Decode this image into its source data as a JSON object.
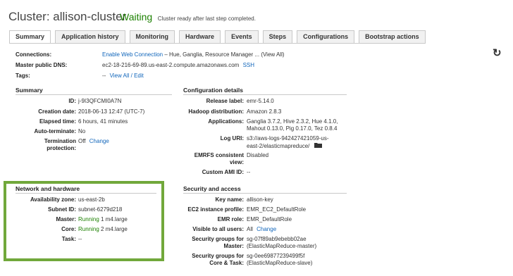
{
  "header": {
    "title": "Cluster: allison-cluster",
    "status": "Waiting",
    "status_message": "Cluster ready after last step completed."
  },
  "tabs": [
    {
      "label": "Summary",
      "active": true
    },
    {
      "label": "Application history"
    },
    {
      "label": "Monitoring"
    },
    {
      "label": "Hardware"
    },
    {
      "label": "Events"
    },
    {
      "label": "Steps"
    },
    {
      "label": "Configurations"
    },
    {
      "label": "Bootstrap actions"
    }
  ],
  "top": {
    "connections_label": "Connections:",
    "connections_link": "Enable Web Connection",
    "connections_rest": " – Hue, Ganglia, Resource Manager ... (View All)",
    "dns_label": "Master public DNS:",
    "dns_value": "ec2-18-216-69-89.us-east-2.compute.amazonaws.com",
    "ssh_link": "SSH",
    "tags_label": "Tags:",
    "tags_prefix": "--",
    "tags_link": "View All / Edit"
  },
  "summary": {
    "heading": "Summary",
    "id_label": "ID:",
    "id_value": "j-9I3QFCMI0A7N",
    "creation_label": "Creation date:",
    "creation_value": "2018-06-13 12:47 (UTC-7)",
    "elapsed_label": "Elapsed time:",
    "elapsed_value": "6 hours, 41 minutes",
    "autoterm_label": "Auto-terminate:",
    "autoterm_value": "No",
    "termprot_label_1": "Termination",
    "termprot_label_2": "protection:",
    "termprot_value": "Off",
    "termprot_change": "Change"
  },
  "config": {
    "heading": "Configuration details",
    "release_label": "Release label:",
    "release_value": "emr-5.14.0",
    "hadoop_label": "Hadoop distribution:",
    "hadoop_value": "Amazon 2.8.3",
    "apps_label": "Applications:",
    "apps_value_1": "Ganglia 3.7.2, Hive 2.3.2, Hue 4.1.0,",
    "apps_value_2": "Mahout 0.13.0, Pig 0.17.0, Tez 0.8.4",
    "log_label": "Log URI:",
    "log_value_1": "s3://aws-logs-942427421059-us-",
    "log_value_2": "east-2/elasticmapreduce/",
    "emrfs_label_1": "EMRFS consistent",
    "emrfs_label_2": "view:",
    "emrfs_value": "Disabled",
    "ami_label": "Custom AMI ID:",
    "ami_value": "--"
  },
  "network": {
    "heading": "Network and hardware",
    "az_label": "Availability zone:",
    "az_value": "us-east-2b",
    "subnet_label": "Subnet ID:",
    "subnet_value": "subnet-6279d218",
    "master_label": "Master:",
    "master_state": "Running",
    "master_rest": "1  m4.large",
    "core_label": "Core:",
    "core_state": "Running",
    "core_rest": "2  m4.large",
    "task_label": "Task:",
    "task_value": "--"
  },
  "security": {
    "heading": "Security and access",
    "key_label": "Key name:",
    "key_value": "allison-key",
    "profile_label": "EC2 instance profile:",
    "profile_value": "EMR_EC2_DefaultRole",
    "role_label": "EMR role:",
    "role_value": "EMR_DefaultRole",
    "visible_label": "Visible to all users:",
    "visible_value": "All",
    "visible_change": "Change",
    "sgm_label_1": "Security groups for",
    "sgm_label_2": "Master:",
    "sgm_link": "sg-07f89ab9ebebb02ae",
    "sgm_name": "(ElasticMapReduce-master)",
    "sgc_label_1": "Security groups for",
    "sgc_label_2": "Core & Task:",
    "sgc_link": "sg-0ee69877239499f5f",
    "sgc_name": "(ElasticMapReduce-slave)"
  },
  "icons": {
    "refresh": "refresh-icon",
    "folder": "folder-icon"
  },
  "colors": {
    "accent_link": "#1166bb",
    "running": "#1d8102",
    "highlight": "#71a83b"
  }
}
